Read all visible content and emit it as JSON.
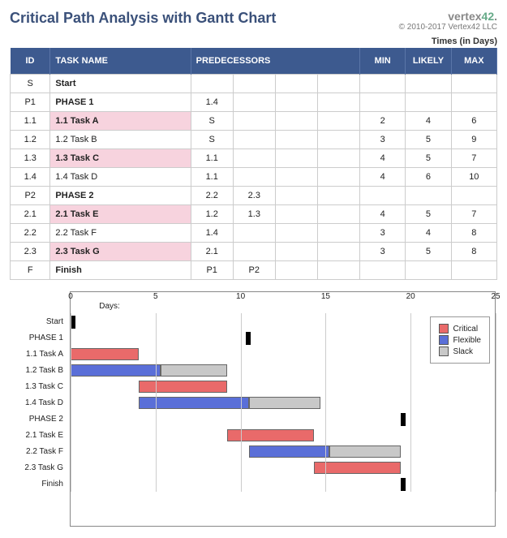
{
  "header": {
    "title": "Critical Path Analysis with Gantt Chart",
    "brand_prefix": "vertex",
    "brand_suffix": "42",
    "copyright": "© 2010-2017 Vertex42 LLC",
    "times_label": "Times (in Days)"
  },
  "columns": {
    "id": "ID",
    "task": "TASK NAME",
    "pred": "PREDECESSORS",
    "min": "MIN",
    "likely": "LIKELY",
    "max": "MAX"
  },
  "rows": [
    {
      "id": "S",
      "name": "Start",
      "pred": [
        "",
        "",
        "",
        ""
      ],
      "min": "",
      "likely": "",
      "max": "",
      "critical": false,
      "phase": true,
      "indent": 0
    },
    {
      "id": "P1",
      "name": "PHASE 1",
      "pred": [
        "1.4",
        "",
        "",
        ""
      ],
      "min": "",
      "likely": "",
      "max": "",
      "critical": false,
      "phase": true,
      "indent": 0
    },
    {
      "id": "1.1",
      "name": "1.1 Task A",
      "pred": [
        "S",
        "",
        "",
        ""
      ],
      "min": "2",
      "likely": "4",
      "max": "6",
      "critical": true,
      "phase": false,
      "indent": 1
    },
    {
      "id": "1.2",
      "name": "1.2 Task B",
      "pred": [
        "S",
        "",
        "",
        ""
      ],
      "min": "3",
      "likely": "5",
      "max": "9",
      "critical": false,
      "phase": false,
      "indent": 1
    },
    {
      "id": "1.3",
      "name": "1.3 Task C",
      "pred": [
        "1.1",
        "",
        "",
        ""
      ],
      "min": "4",
      "likely": "5",
      "max": "7",
      "critical": true,
      "phase": false,
      "indent": 1
    },
    {
      "id": "1.4",
      "name": "1.4 Task D",
      "pred": [
        "1.1",
        "",
        "",
        ""
      ],
      "min": "4",
      "likely": "6",
      "max": "10",
      "critical": false,
      "phase": false,
      "indent": 1
    },
    {
      "id": "P2",
      "name": "PHASE 2",
      "pred": [
        "2.2",
        "2.3",
        "",
        ""
      ],
      "min": "",
      "likely": "",
      "max": "",
      "critical": false,
      "phase": true,
      "indent": 0
    },
    {
      "id": "2.1",
      "name": "2.1 Task E",
      "pred": [
        "1.2",
        "1.3",
        "",
        ""
      ],
      "min": "4",
      "likely": "5",
      "max": "7",
      "critical": true,
      "phase": false,
      "indent": 1
    },
    {
      "id": "2.2",
      "name": "2.2 Task F",
      "pred": [
        "1.4",
        "",
        "",
        ""
      ],
      "min": "3",
      "likely": "4",
      "max": "8",
      "critical": false,
      "phase": false,
      "indent": 1
    },
    {
      "id": "2.3",
      "name": "2.3 Task G",
      "pred": [
        "2.1",
        "",
        "",
        ""
      ],
      "min": "3",
      "likely": "5",
      "max": "8",
      "critical": true,
      "phase": false,
      "indent": 1
    },
    {
      "id": "F",
      "name": "Finish",
      "pred": [
        "P1",
        "P2",
        "",
        ""
      ],
      "min": "",
      "likely": "",
      "max": "",
      "critical": false,
      "phase": true,
      "indent": 0
    }
  ],
  "legend": {
    "critical": "Critical",
    "flexible": "Flexible",
    "slack": "Slack"
  },
  "chart_data": {
    "type": "gantt",
    "title": "",
    "xlabel": "Days:",
    "xlim": [
      0,
      25
    ],
    "xticks": [
      0,
      5,
      10,
      15,
      20,
      25
    ],
    "categories": [
      "Start",
      "PHASE 1",
      "1.1 Task A",
      "1.2 Task B",
      "1.3 Task C",
      "1.4 Task D",
      "PHASE 2",
      "2.1 Task E",
      "2.2 Task F",
      "2.3 Task G",
      "Finish"
    ],
    "series": [
      {
        "name": "Critical",
        "color": "#e96a6a"
      },
      {
        "name": "Flexible",
        "color": "#5a6fd8"
      },
      {
        "name": "Slack",
        "color": "#c8c8c8"
      },
      {
        "name": "Milestone",
        "color": "#000"
      }
    ],
    "bars": [
      {
        "row": 0,
        "type": "milestone",
        "start": 0,
        "end": 0.3
      },
      {
        "row": 1,
        "type": "milestone",
        "start": 10.3,
        "end": 10.6
      },
      {
        "row": 2,
        "type": "critical",
        "start": 0,
        "end": 4
      },
      {
        "row": 3,
        "type": "flexible",
        "start": 0,
        "end": 5.3
      },
      {
        "row": 3,
        "type": "slack",
        "start": 5.3,
        "end": 9.2
      },
      {
        "row": 4,
        "type": "critical",
        "start": 4,
        "end": 9.2
      },
      {
        "row": 5,
        "type": "flexible",
        "start": 4,
        "end": 10.5
      },
      {
        "row": 5,
        "type": "slack",
        "start": 10.5,
        "end": 14.7
      },
      {
        "row": 6,
        "type": "milestone",
        "start": 19.4,
        "end": 19.7
      },
      {
        "row": 7,
        "type": "critical",
        "start": 9.2,
        "end": 14.3
      },
      {
        "row": 8,
        "type": "flexible",
        "start": 10.5,
        "end": 15.2
      },
      {
        "row": 8,
        "type": "slack",
        "start": 15.2,
        "end": 19.4
      },
      {
        "row": 9,
        "type": "critical",
        "start": 14.3,
        "end": 19.4
      },
      {
        "row": 10,
        "type": "milestone",
        "start": 19.4,
        "end": 19.7
      }
    ]
  }
}
